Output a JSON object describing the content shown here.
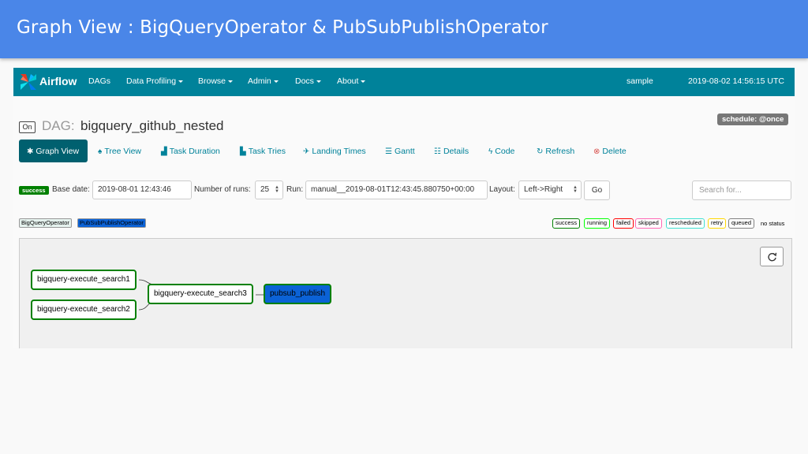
{
  "slide": {
    "title": "Graph View : BigQueryOperator & PubSubPublishOperator"
  },
  "navbar": {
    "brand": "Airflow",
    "items": [
      "DAGs",
      "Data Profiling",
      "Browse",
      "Admin",
      "Docs",
      "About"
    ],
    "user": "sample",
    "datetime": "2019-08-02 14:56:15 UTC"
  },
  "dag": {
    "toggle": "On",
    "label": "DAG:",
    "id": "bigquery_github_nested",
    "schedule": "schedule: @once"
  },
  "tabs": [
    "Graph View",
    "Tree View",
    "Task Duration",
    "Task Tries",
    "Landing Times",
    "Gantt",
    "Details",
    "Code",
    "Refresh",
    "Delete"
  ],
  "filters": {
    "state_badge": "success",
    "base_date_label": "Base date:",
    "base_date": "2019-08-01 12:43:46",
    "runs_label": "Number of runs:",
    "runs": "25",
    "run_label": "Run:",
    "run": "manual__2019-08-01T12:43:45.880750+00:00",
    "layout_label": "Layout:",
    "layout": "Left->Right",
    "go": "Go",
    "search_placeholder": "Search for..."
  },
  "operators": [
    {
      "name": "BigQueryOperator",
      "color": "#e5f2ee"
    },
    {
      "name": "PubSubPublishOperator",
      "color": "#0b62d6"
    }
  ],
  "legend": [
    {
      "name": "success",
      "color": "#008000"
    },
    {
      "name": "running",
      "color": "#00ff00"
    },
    {
      "name": "failed",
      "color": "#ff0000"
    },
    {
      "name": "skipped",
      "color": "#ff69b4"
    },
    {
      "name": "rescheduled",
      "color": "#40e0d0"
    },
    {
      "name": "retry",
      "color": "#ffd700"
    },
    {
      "name": "queued",
      "color": "#808080"
    }
  ],
  "legend_no_status": "no status",
  "graph": {
    "nodes": [
      {
        "id": "bigquery-execute_search1"
      },
      {
        "id": "bigquery-execute_search2"
      },
      {
        "id": "bigquery-execute_search3"
      },
      {
        "id": "pubsub_publish"
      }
    ]
  }
}
